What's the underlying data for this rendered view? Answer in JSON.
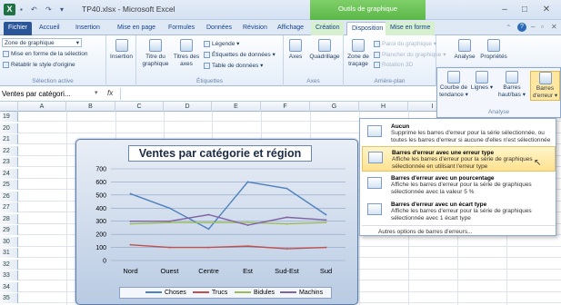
{
  "window": {
    "title": "TP40.xlsx - Microsoft Excel",
    "context_title": "Outils de graphique",
    "controls": [
      "minimize-icon",
      "restore-icon",
      "close-icon"
    ]
  },
  "qat": {
    "undo_glyph": "↶",
    "redo_glyph": "↷",
    "more_glyph": "▾"
  },
  "tabs": [
    {
      "label": "Fichier"
    },
    {
      "label": "Accueil"
    },
    {
      "label": "Insertion"
    },
    {
      "label": "Mise en page"
    },
    {
      "label": "Formules"
    },
    {
      "label": "Données"
    },
    {
      "label": "Révision"
    },
    {
      "label": "Affichage"
    },
    {
      "label": "Création"
    },
    {
      "label": "Disposition"
    },
    {
      "label": "Mise en forme"
    }
  ],
  "ribbon": {
    "selection": {
      "combo_value": "Zone de graphique",
      "format_selection": "Mise en forme de la sélection",
      "reset_style": "Rétablir le style d'origine",
      "group_label": "Sélection active"
    },
    "insertion": {
      "label": "Insertion"
    },
    "etiquettes": {
      "titre_graphique": "Titre du graphique",
      "titres_axes": "Titres des axes",
      "legende": "Légende",
      "etiquettes_donnees": "Étiquettes de données",
      "table_donnees": "Table de données",
      "group_label": "Étiquettes"
    },
    "axes": {
      "axes": "Axes",
      "quadrillage": "Quadrillage",
      "group_label": "Axes"
    },
    "arriere_plan": {
      "zone_trace": "Zone de traçage",
      "paroi": "Paroi du graphique",
      "plancher": "Plancher du graphique",
      "rotation": "Rotation 3D",
      "group_label": "Arrière-plan"
    },
    "analyse": {
      "label": "Analyse"
    },
    "proprietes": {
      "label": "Propriétés"
    }
  },
  "analyse_popup": {
    "buttons": [
      "Courbe de tendance",
      "Lignes",
      "Barres haut/bas",
      "Barres d'erreur"
    ],
    "group_label": "Analyse"
  },
  "formula_bar": {
    "name_box": "Ventes par catégori...",
    "fx": "fx"
  },
  "grid": {
    "columns": [
      "A",
      "B",
      "C",
      "D",
      "E",
      "F",
      "G",
      "H",
      "I"
    ],
    "rows": [
      "19",
      "20",
      "21",
      "22",
      "23",
      "24",
      "25",
      "26",
      "27",
      "28",
      "29",
      "30",
      "31",
      "32",
      "33",
      "34",
      "35"
    ]
  },
  "chart_data": {
    "type": "line",
    "title": "Ventes par catégorie et région",
    "categories": [
      "Nord",
      "Ouest",
      "Centre",
      "Est",
      "Sud-Est",
      "Sud"
    ],
    "yticks": [
      0,
      100,
      200,
      300,
      400,
      500,
      600,
      700
    ],
    "ylim": [
      0,
      700
    ],
    "grid": true,
    "legend_position": "bottom",
    "series": [
      {
        "name": "Choses",
        "color": "#4f81bd",
        "values": [
          510,
          400,
          240,
          600,
          550,
          350
        ]
      },
      {
        "name": "Trucs",
        "color": "#c0504d",
        "values": [
          120,
          100,
          100,
          110,
          90,
          100
        ]
      },
      {
        "name": "Bidules",
        "color": "#9bbb59",
        "values": [
          280,
          290,
          290,
          290,
          280,
          290
        ]
      },
      {
        "name": "Machins",
        "color": "#8064a2",
        "values": [
          300,
          300,
          350,
          270,
          330,
          310
        ]
      }
    ]
  },
  "dropdown": {
    "items": [
      {
        "title": "Aucun",
        "desc": "Supprime les barres d'erreur pour la série sélectionnée, ou toutes les barres d'erreur si aucune d'elles n'est sélectionnée",
        "highlighted": false
      },
      {
        "title": "Barres d'erreur avec une erreur type",
        "desc": "Affiche les barres d'erreur pour la série de graphiques sélectionnée en utilisant l'erreur type",
        "highlighted": true
      },
      {
        "title": "Barres d'erreur avec un pourcentage",
        "desc": "Affiche les barres d'erreur pour la série de graphiques sélectionnée avec la valeur 5 %",
        "highlighted": false
      },
      {
        "title": "Barres d'erreur avec un écart type",
        "desc": "Affiche les barres d'erreur pour la série de graphiques sélectionnée avec 1 écart type",
        "highlighted": false
      }
    ],
    "footer": "Autres options de barres d'erreurs..."
  },
  "colors": {
    "excel_green": "#1f7244",
    "ribbon_blue": "#2a5699",
    "context_green": "#5bb749",
    "highlight": "#ffe18f"
  }
}
